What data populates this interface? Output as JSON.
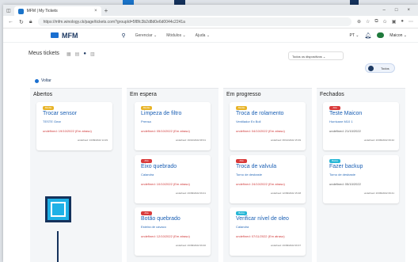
{
  "browser": {
    "tab_title": "MFM | My Tickets",
    "url": "https://mfm.winology.ck/page/tickets.com?groupId=5f8fc3b2d8d0e6d0044c2241a",
    "tab_close": "×",
    "new_tab": "+",
    "controls": {
      "min": "–",
      "max": "□",
      "close": "×"
    }
  },
  "app": {
    "logo": "MFM",
    "menu": [
      {
        "label": "Gerenciar ⌄"
      },
      {
        "label": "Módulos ⌄"
      },
      {
        "label": "Ajuda ⌄"
      }
    ],
    "lang": "PT ⌄",
    "user_name": "Maicon ⌄"
  },
  "page": {
    "title": "Meus tickets",
    "filter": "Todos os dispositivos ⌄",
    "toggle_label": "Todos",
    "back": "Voltar"
  },
  "columns": [
    {
      "title": "Abertos",
      "cards": [
        {
          "priority": "Média",
          "title": "Trocar sensor",
          "subtitle": "TESTE Gear",
          "date": "undefined: 19/10/2022 (Em atraso)",
          "overdue": true,
          "updated": "undefined: 13/09/2022 14:29"
        }
      ]
    },
    {
      "title": "Em espera",
      "cards": [
        {
          "priority": "Média",
          "title": "Limpeza de filtro",
          "subtitle": "Prensa",
          "date": "undefined: 05/10/2022 (Em atraso)",
          "overdue": true,
          "updated": "undefined: 19/10/2022 08:31"
        },
        {
          "priority": "Alta",
          "title": "Eixo quebrado",
          "subtitle": "Calandra",
          "date": "undefined: 10/10/2022 (Em atraso)",
          "overdue": true,
          "updated": "undefined: 23/09/2022 09:41"
        },
        {
          "priority": "Alta",
          "title": "Botão quebrado",
          "subtitle": "Esteira de cavaco",
          "date": "undefined: 12/10/2022 (Em atraso)",
          "overdue": true,
          "updated": "undefined: 23/09/2022 09:40"
        }
      ]
    },
    {
      "title": "Em progresso",
      "cards": [
        {
          "priority": "Média",
          "title": "Troca de rolamento",
          "subtitle": "Ventilador Ex Boll",
          "date": "undefined: 04/10/2022 (Em atraso)",
          "overdue": true,
          "updated": "undefined: 06/12/2022 15:39"
        },
        {
          "priority": "Alta",
          "title": "Troca de valvula",
          "subtitle": "Torno de desbaste",
          "date": "undefined: 24/10/2022 (Em atraso)",
          "overdue": true,
          "updated": "undefined: 12/09/2022 15:48"
        },
        {
          "priority": "Baixa",
          "title": "Verificar nível de oleo",
          "subtitle": "Calandra",
          "date": "undefined: 07/11/2022 (Em atraso)",
          "overdue": true,
          "updated": "undefined: 23/09/2022 09:37"
        }
      ]
    },
    {
      "title": "Fechados",
      "cards": [
        {
          "priority": "Alta",
          "title": "Teste Maicon",
          "subtitle": "Hurricane M10 1",
          "date": "undefined: 21/10/2022",
          "overdue": false,
          "updated": "undefined: 23/09/2022 09:42"
        },
        {
          "priority": "Baixa",
          "title": "Fazer backup",
          "subtitle": "Torno de desbaste",
          "date": "undefined: 05/10/2022",
          "overdue": false,
          "updated": "undefined: 23/09/2022 09:41"
        }
      ]
    }
  ]
}
